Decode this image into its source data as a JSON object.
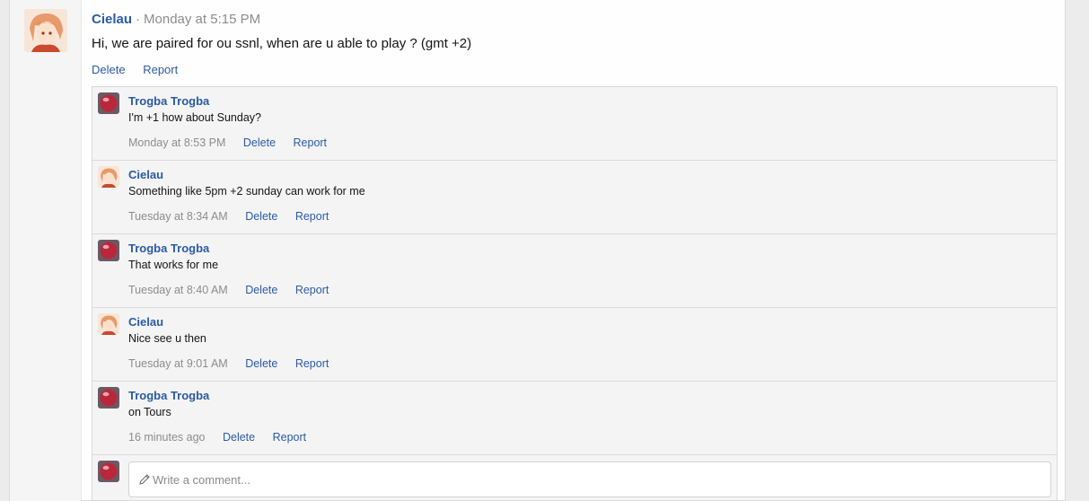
{
  "post": {
    "author": "Cielau",
    "separator": "·",
    "time": "Monday at 5:15 PM",
    "body": "Hi, we are paired for ou ssnl, when are u able to play ? (gmt +2)",
    "actions": {
      "delete": "Delete",
      "report": "Report"
    }
  },
  "comments": [
    {
      "author": "Trogba Trogba",
      "avatar": "red-ball-icon",
      "text": "I'm +1 how about Sunday?",
      "time": "Monday at 8:53 PM",
      "delete": "Delete",
      "report": "Report"
    },
    {
      "author": "Cielau",
      "avatar": "anime-character-avatar",
      "text": "Something like 5pm +2 sunday can work for me",
      "time": "Tuesday at 8:34 AM",
      "delete": "Delete",
      "report": "Report"
    },
    {
      "author": "Trogba Trogba",
      "avatar": "red-ball-icon",
      "text": "That works for me",
      "time": "Tuesday at 8:40 AM",
      "delete": "Delete",
      "report": "Report"
    },
    {
      "author": "Cielau",
      "avatar": "anime-character-avatar",
      "text": "Nice see u then",
      "time": "Tuesday at 9:01 AM",
      "delete": "Delete",
      "report": "Report"
    },
    {
      "author": "Trogba Trogba",
      "avatar": "red-ball-icon",
      "text": "on Tours",
      "time": "16 minutes ago",
      "delete": "Delete",
      "report": "Report"
    }
  ],
  "composer": {
    "placeholder": "Write a comment...",
    "icon": "pencil-icon"
  },
  "colors": {
    "link": "#2b5aa6",
    "muted": "#8c8c8c",
    "thread_bg": "#f4f4f4"
  }
}
